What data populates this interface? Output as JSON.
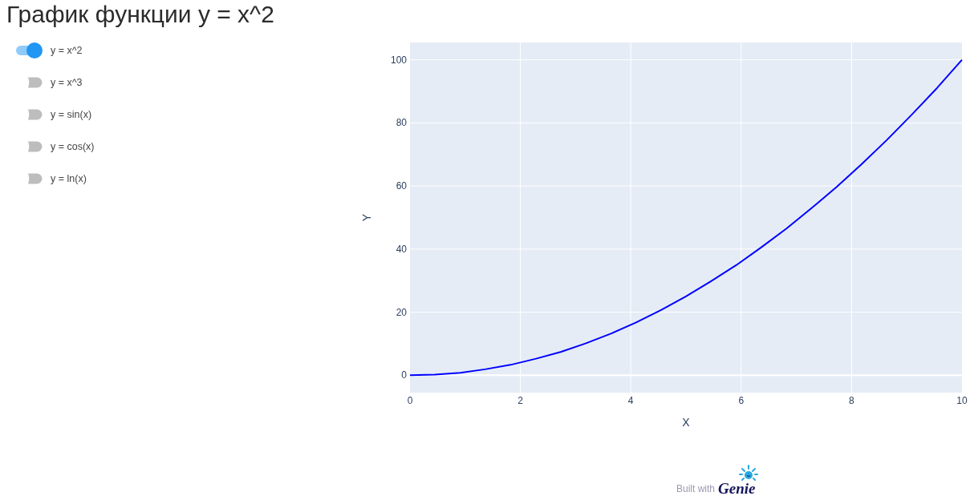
{
  "title": "График функции y = x^2",
  "functions": [
    {
      "label": "y = x^2",
      "on": true
    },
    {
      "label": "y = x^3",
      "on": false
    },
    {
      "label": "y = sin(x)",
      "on": false
    },
    {
      "label": "y = cos(x)",
      "on": false
    },
    {
      "label": "y = ln(x)",
      "on": false
    }
  ],
  "chart": {
    "chart_data": {
      "type": "line",
      "xlabel": "X",
      "ylabel": "Y",
      "x": [
        0,
        0.45,
        0.91,
        1.36,
        1.82,
        2.27,
        2.73,
        3.18,
        3.64,
        4.09,
        4.55,
        5,
        5.45,
        5.91,
        6.36,
        6.82,
        7.27,
        7.73,
        8.18,
        8.64,
        9.09,
        9.55,
        10
      ],
      "series": [
        {
          "color": "#0000ff",
          "values": [
            0,
            0.2,
            0.8,
            1.9,
            3.3,
            5.2,
            7.4,
            10.1,
            13.2,
            16.7,
            20.7,
            25,
            29.8,
            34.9,
            40.5,
            46.5,
            52.9,
            59.7,
            66.9,
            74.6,
            82.6,
            91.1,
            100
          ]
        }
      ],
      "xlim": [
        0,
        10
      ],
      "ylim": [
        -5.5,
        105.5
      ],
      "xticks": [
        0,
        2,
        4,
        6,
        8,
        10
      ],
      "yticks": [
        0,
        20,
        40,
        60,
        80,
        100
      ],
      "grid": true
    }
  },
  "footer": {
    "text": "Built with",
    "logo": "Genie"
  }
}
